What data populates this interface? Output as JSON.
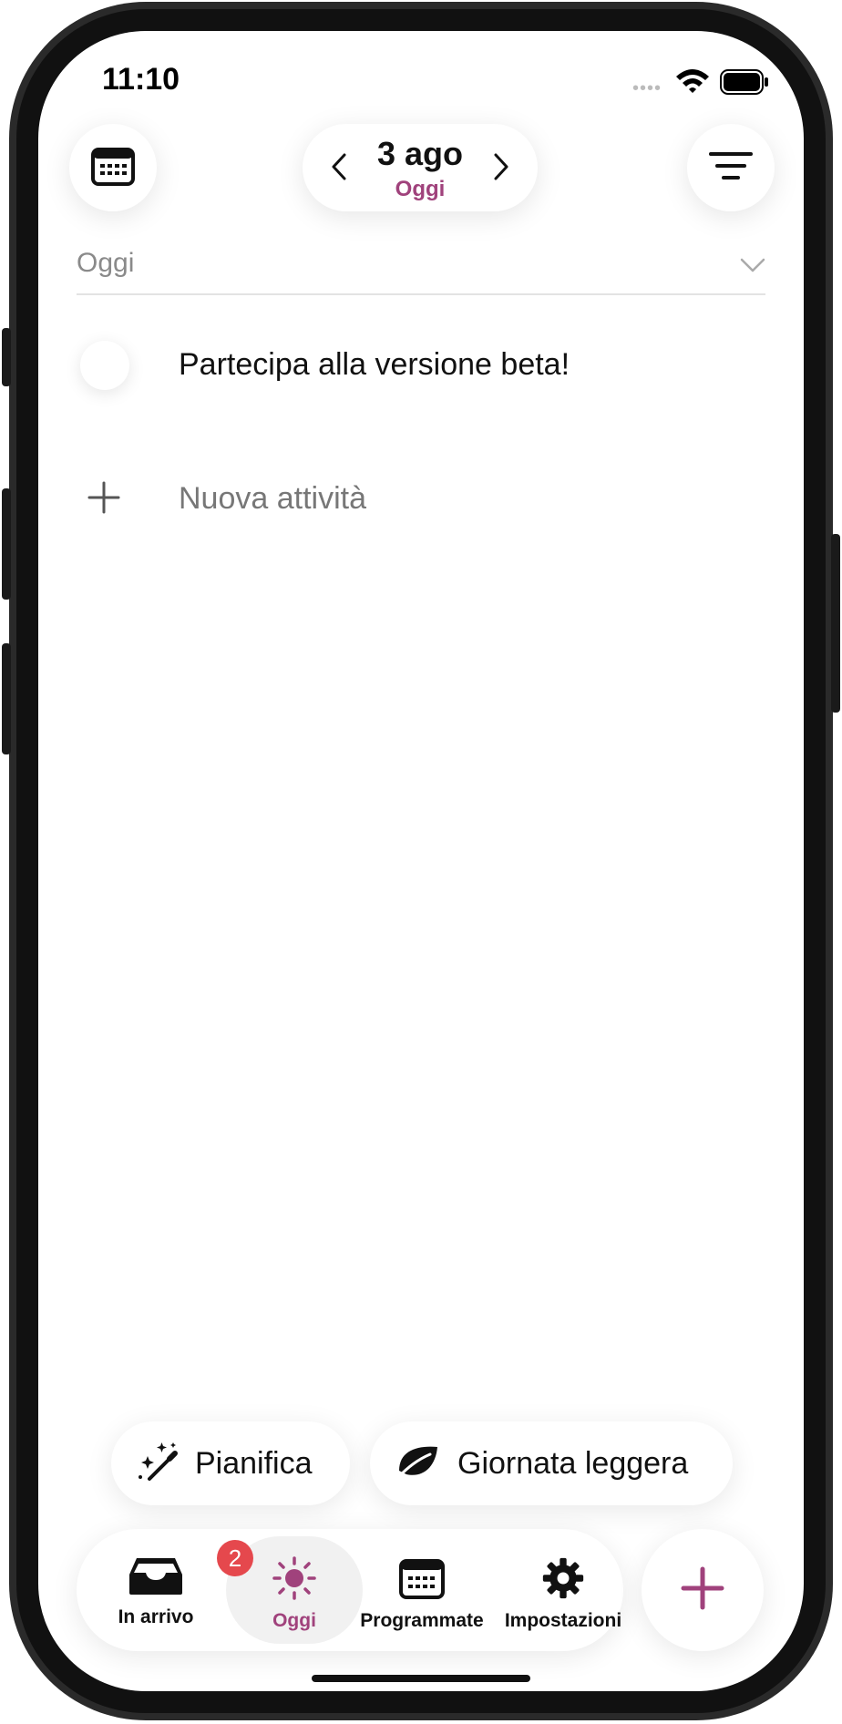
{
  "status_bar": {
    "time": "11:10",
    "signal": "••••"
  },
  "header": {
    "date_main": "3 ago",
    "date_sub": "Oggi"
  },
  "section": {
    "label": "Oggi"
  },
  "tasks": [
    {
      "title": "Partecipa alla versione beta!"
    }
  ],
  "new_task_label": "Nuova attività",
  "actions": {
    "plan_label": "Pianifica",
    "light_day_label": "Giornata leggera"
  },
  "tabbar": {
    "inbox": {
      "label": "In arrivo",
      "badge": "2"
    },
    "today": {
      "label": "Oggi"
    },
    "scheduled": {
      "label": "Programmate"
    },
    "settings": {
      "label": "Impostazioni"
    }
  },
  "colors": {
    "accent": "#a0427c",
    "badge": "#e5484d"
  }
}
